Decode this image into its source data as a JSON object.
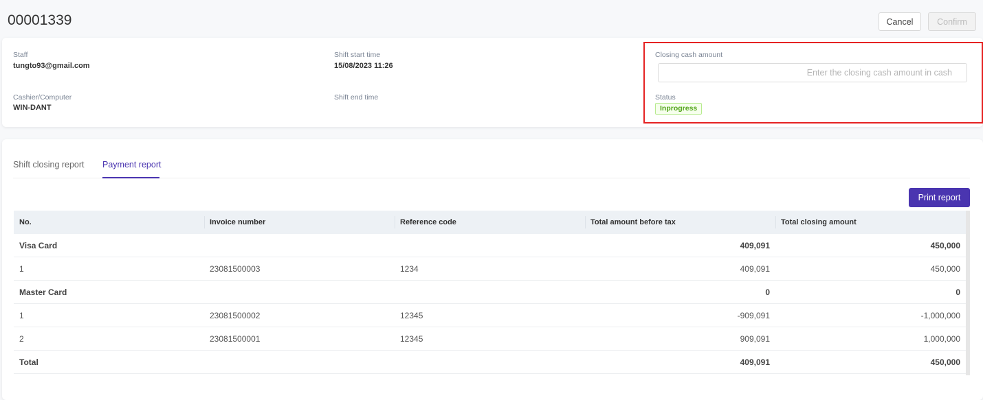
{
  "header": {
    "title": "00001339",
    "cancel": "Cancel",
    "confirm": "Confirm"
  },
  "info": {
    "staff_label": "Staff",
    "staff": "tungto93@gmail.com",
    "cashier_label": "Cashier/Computer",
    "cashier": "WIN-DANT",
    "start_label": "Shift start time",
    "start": "15/08/2023 11:26",
    "end_label": "Shift end time",
    "closing_label": "Closing cash amount",
    "closing_placeholder": "Enter the closing cash amount in cash",
    "status_label": "Status",
    "status": "Inprogress"
  },
  "tabs": [
    "Shift closing report",
    "Payment report"
  ],
  "print": "Print report",
  "table": {
    "headers": [
      "No.",
      "Invoice number",
      "Reference code",
      "Total amount before tax",
      "Total closing amount"
    ],
    "rows": [
      [
        "Visa Card",
        "",
        "",
        "409,091",
        "450,000"
      ],
      [
        "1",
        "23081500003",
        "1234",
        "409,091",
        "450,000"
      ],
      [
        "Master Card",
        "",
        "",
        "0",
        "0"
      ],
      [
        "1",
        "23081500002",
        "12345",
        "-909,091",
        "-1,000,000"
      ],
      [
        "2",
        "23081500001",
        "12345",
        "909,091",
        "1,000,000"
      ],
      [
        "Total",
        "",
        "",
        "409,091",
        "450,000"
      ]
    ]
  }
}
